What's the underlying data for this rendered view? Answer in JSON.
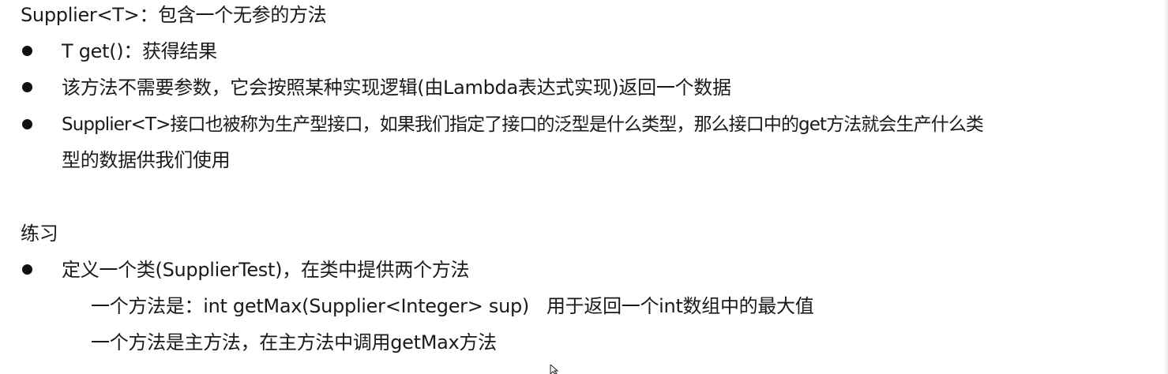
{
  "heading": "Supplier<T>：包含一个无参的方法",
  "bullets": [
    "T get()：获得结果",
    "该方法不需要参数，它会按照某种实现逻辑(由Lambda表达式实现)返回一个数据",
    "Supplier<T>接口也被称为生产型接口，如果我们指定了接口的泛型是什么类型，那么接口中的get方法就会生产什么类",
    "型的数据供我们使用"
  ],
  "exercise": {
    "title": "练习",
    "bullet": "定义一个类(SupplierTest)，在类中提供两个方法",
    "sub_items": [
      "一个方法是：int getMax(Supplier<Integer> sup)   用于返回一个int数组中的最大值",
      "一个方法是主方法，在主方法中调用getMax方法"
    ]
  }
}
